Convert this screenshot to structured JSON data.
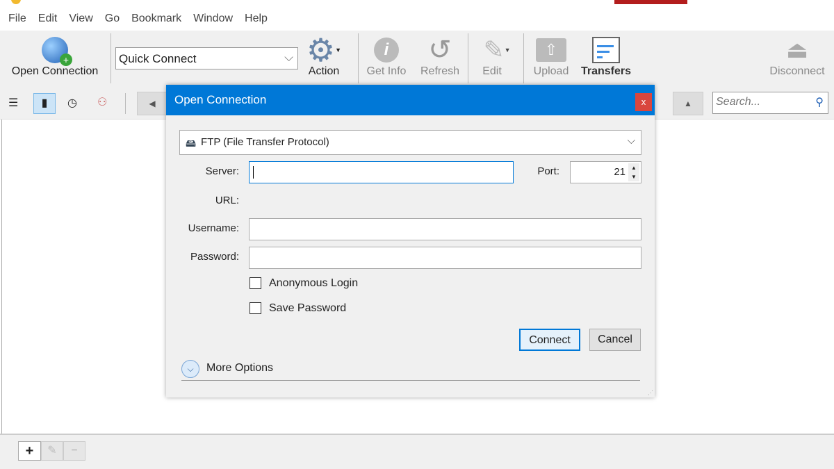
{
  "menu": [
    "File",
    "Edit",
    "View",
    "Go",
    "Bookmark",
    "Window",
    "Help"
  ],
  "toolbar": {
    "open_connection": "Open Connection",
    "quick_connect": "Quick Connect",
    "action": "Action",
    "get_info": "Get Info",
    "refresh": "Refresh",
    "edit": "Edit",
    "upload": "Upload",
    "transfers": "Transfers",
    "disconnect": "Disconnect"
  },
  "search": {
    "placeholder": "Search..."
  },
  "dialog": {
    "title": "Open Connection",
    "close": "x",
    "protocol": "FTP (File Transfer Protocol)",
    "server_label": "Server:",
    "server_value": "",
    "port_label": "Port:",
    "port_value": "21",
    "url_label": "URL:",
    "username_label": "Username:",
    "password_label": "Password:",
    "anonymous": "Anonymous Login",
    "save_password": "Save Password",
    "connect": "Connect",
    "cancel": "Cancel",
    "more_options": "More Options"
  },
  "bottom": {
    "add": "+",
    "remove": "−"
  }
}
